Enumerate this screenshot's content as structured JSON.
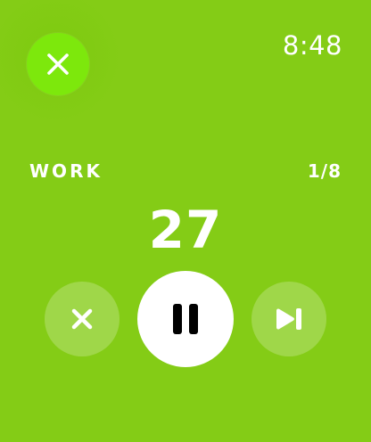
{
  "header": {
    "close_icon": "close-icon",
    "clock": "8:48"
  },
  "workout": {
    "phase_label": "WORK",
    "progress": "1/8",
    "seconds_remaining": "27"
  },
  "controls": {
    "cancel_icon": "close-icon",
    "pause_icon": "pause-icon",
    "skip_icon": "skip-next-icon"
  },
  "colors": {
    "background": "#84cc16",
    "close_button": "#7de80c",
    "text": "#ffffff",
    "pause_button": "#ffffff",
    "icon_dark": "#000000"
  }
}
